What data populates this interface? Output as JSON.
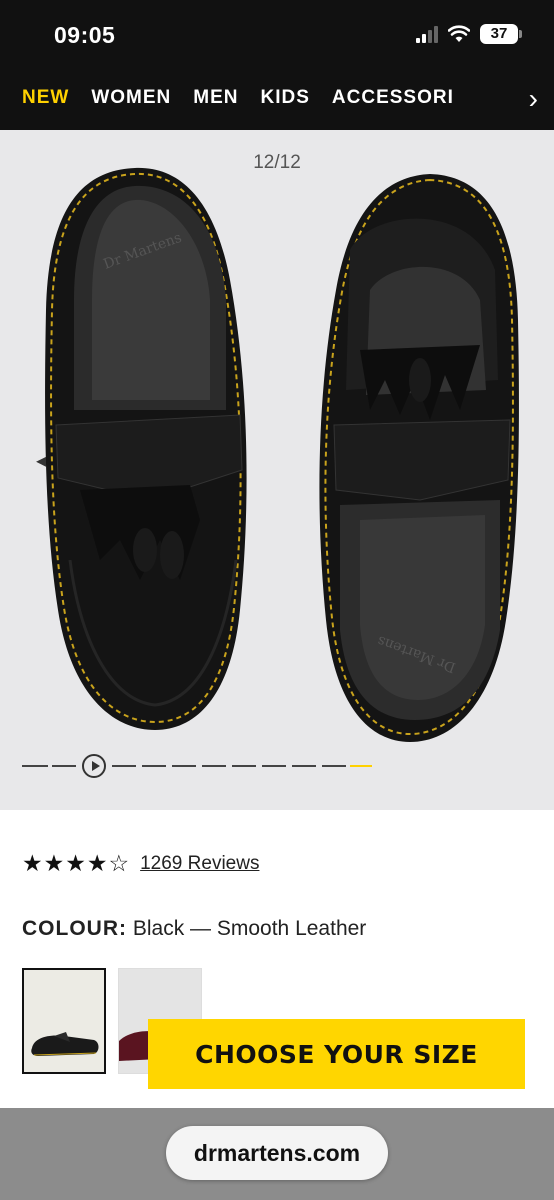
{
  "status": {
    "time": "09:05",
    "battery": "37"
  },
  "nav": {
    "items": [
      "NEW",
      "WOMEN",
      "MEN",
      "KIDS",
      "ACCESSORI"
    ],
    "active_index": 0
  },
  "gallery": {
    "counter": "12/12",
    "total_slides": 12,
    "current_slide": 12
  },
  "product": {
    "rating": 4,
    "rating_max": 5,
    "reviews_label": "1269 Reviews",
    "colour_label": "COLOUR:",
    "colour_value": "Black — Smooth Leather"
  },
  "cta": {
    "label": "CHOOSE YOUR SIZE"
  },
  "browser": {
    "url": "drmartens.com"
  },
  "colors": {
    "accent": "#ffd100",
    "topbar": "#111111",
    "gallery_bg": "#e8e8ea",
    "cta": "#ffd600"
  }
}
